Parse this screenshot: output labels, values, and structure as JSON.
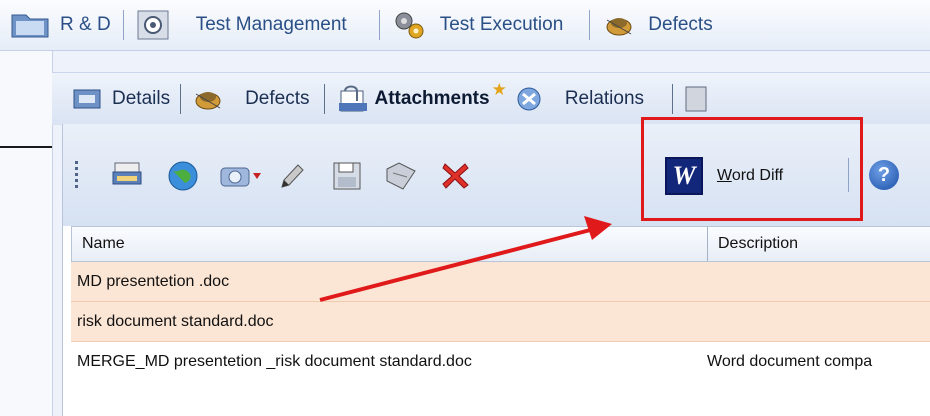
{
  "top_modules": [
    {
      "label": "R & D",
      "icon": "folder-icon"
    },
    {
      "label": "Test Management",
      "icon": "monitor-icon"
    },
    {
      "label": "Test Execution",
      "icon": "gears-icon"
    },
    {
      "label": "Defects",
      "icon": "bug-icon"
    }
  ],
  "tabs": [
    {
      "label": "Details",
      "icon": "details-icon"
    },
    {
      "label": "Defects",
      "icon": "bug-icon"
    },
    {
      "label": "Attachments",
      "icon": "attachment-icon",
      "active": true,
      "star": "★"
    },
    {
      "label": "Relations",
      "icon": "relations-icon"
    }
  ],
  "toolbar": {
    "word_diff_label_first": "W",
    "word_diff_label_rest": "ord Diff",
    "help_glyph": "?"
  },
  "grid": {
    "columns": [
      "Name",
      "Description"
    ],
    "rows": [
      {
        "name": "MD presentetion .doc",
        "description": "",
        "selected": true
      },
      {
        "name": "risk document standard.doc",
        "description": "",
        "selected": true
      },
      {
        "name": "MERGE_MD presentetion _risk document standard.doc",
        "description": "Word document compa",
        "selected": false
      }
    ]
  },
  "colors": {
    "accent": "#2a4f86",
    "selected_row": "#fbe5d4",
    "highlight": "#e01a1a"
  }
}
